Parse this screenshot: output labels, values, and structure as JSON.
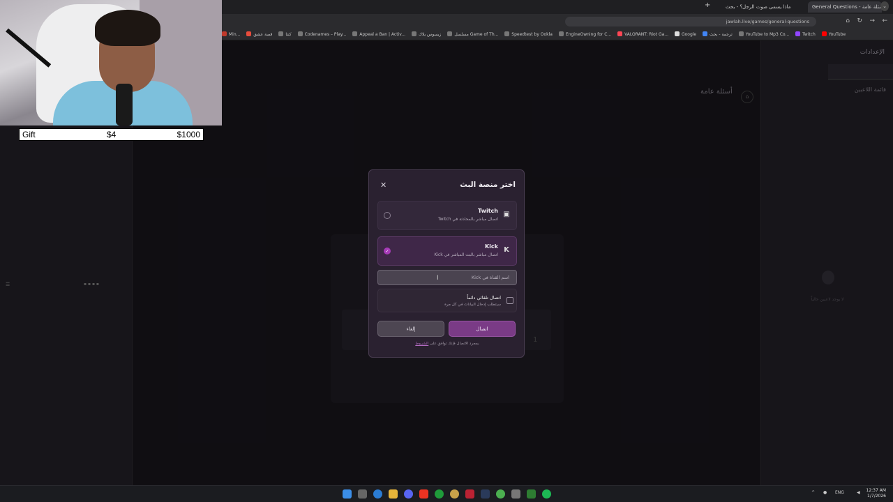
{
  "browser": {
    "tabs": [
      {
        "label": "ماذا يسمى صوت الرجل؟ - بحث",
        "active": false
      },
      {
        "label": "General Questions - أسئلة عامة",
        "active": true
      }
    ],
    "url": "jawlah.live/games/general-questions",
    "bookmarks": [
      "YouTube",
      "Twitch",
      "YouTube to Mp3 Co...",
      "ترجمة - بحث",
      "Google",
      "VALORANT: Riot Ga...",
      "EngineOwning for C...",
      "Speedtest by Ookla",
      "مسلسل Game of Th...",
      "زيسوس يلاك",
      "Appeal a Ban | Activ...",
      "Codenames – Play...",
      "كنتا",
      "قصة عشق",
      "Min..."
    ]
  },
  "overlay": {
    "gift_label": "Gift",
    "gift_price": "$4",
    "gift_goal": "$1000"
  },
  "page": {
    "game_title": "أسئلة عامة",
    "settings_title": "الإعدادات",
    "players_title": "قائمة اللاعبين",
    "empty_text": "لا يوجد لاعبين حالياً"
  },
  "modal": {
    "title": "اختر منصة البث",
    "options": [
      {
        "name": "Twitch",
        "desc": "اتصال مباشر بالمحادثة في Twitch",
        "selected": false,
        "icon": "twitch-icon"
      },
      {
        "name": "Kick",
        "desc": "اتصال مباشر بالبث المباشر في Kick",
        "selected": true,
        "icon": "kick-icon"
      }
    ],
    "input_placeholder": "اسم القناة في Kick",
    "auto_connect_title": "اتصال تلقائي دائماً",
    "auto_connect_desc": "سيتطلب إدخال البيانات في كل مرة",
    "connect_label": "اتصال",
    "cancel_label": "إلغاء",
    "note_prefix": "بمجرد الاتصال فإنك توافق على",
    "note_link": "الشروط"
  },
  "taskbar": {
    "lang": "ENG",
    "time": "12:37 AM",
    "date": "1/7/2026"
  },
  "colors": {
    "accent": "#7a3b86",
    "modal_bg": "#2a2130",
    "page_bg": "#131116"
  }
}
